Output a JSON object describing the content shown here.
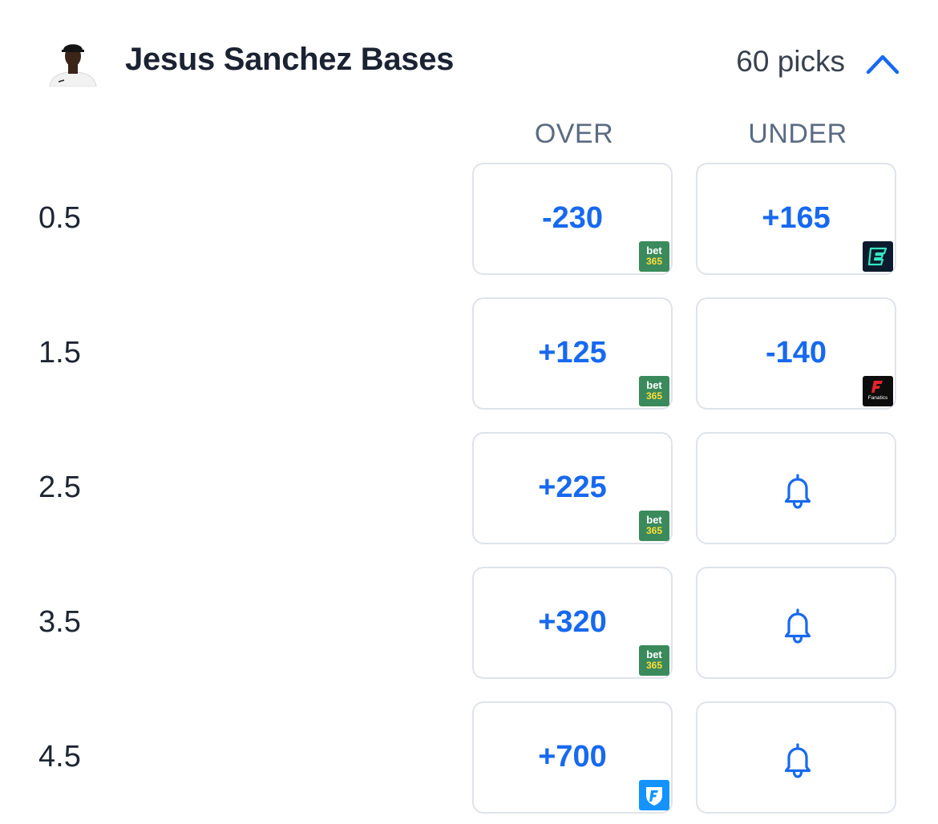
{
  "header": {
    "title": "Jesus Sanchez Bases",
    "picks_label": "60 picks"
  },
  "columns": {
    "over": "OVER",
    "under": "UNDER"
  },
  "colors": {
    "accent": "#1769f0",
    "bet365": "#3a8a5b",
    "fanduel": "#1493ff"
  },
  "rows": [
    {
      "line": "0.5",
      "over": {
        "odds": "-230",
        "book": "bet365"
      },
      "under": {
        "odds": "+165",
        "book": "espnbet"
      }
    },
    {
      "line": "1.5",
      "over": {
        "odds": "+125",
        "book": "bet365"
      },
      "under": {
        "odds": "-140",
        "book": "fanatics"
      }
    },
    {
      "line": "2.5",
      "over": {
        "odds": "+225",
        "book": "bet365"
      },
      "under": {
        "odds": null,
        "icon": "bell-icon"
      }
    },
    {
      "line": "3.5",
      "over": {
        "odds": "+320",
        "book": "bet365"
      },
      "under": {
        "odds": null,
        "icon": "bell-icon"
      }
    },
    {
      "line": "4.5",
      "over": {
        "odds": "+700",
        "book": "fanduel"
      },
      "under": {
        "odds": null,
        "icon": "bell-icon"
      }
    }
  ],
  "book_logos": {
    "bet365": {
      "line1": "bet",
      "line2": "365"
    },
    "fanatics": {
      "text": "Fanatics"
    }
  }
}
